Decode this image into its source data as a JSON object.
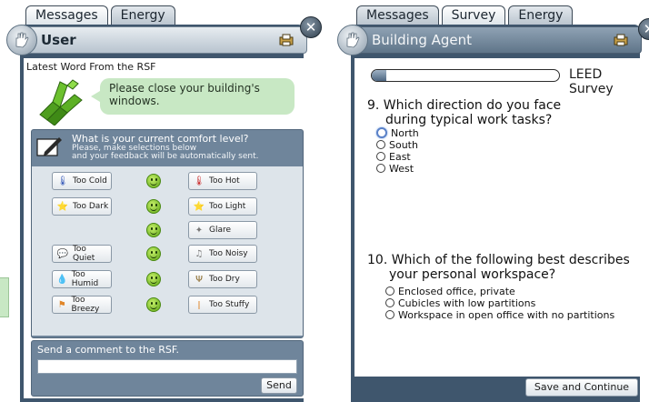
{
  "user_panel": {
    "tabs": [
      "Messages",
      "Energy"
    ],
    "title": "User",
    "latest_word_label": "Latest Word From the RSF",
    "message": "Please close your building's windows.",
    "comfort": {
      "question": "What is your current comfort level?",
      "note_line1": "Please, make selections below",
      "note_line2": "and your feedback will be automatically sent.",
      "left_buttons": [
        {
          "label": "Too Cold",
          "icon": "thermometer-cold-icon"
        },
        {
          "label": "Too Dark",
          "icon": "lamp-icon"
        },
        {
          "label": "Too Quiet",
          "icon": "speech-bubble-icon"
        },
        {
          "label": "Too Humid",
          "icon": "water-drop-icon"
        },
        {
          "label": "Too Breezy",
          "icon": "flag-icon"
        }
      ],
      "right_buttons": [
        {
          "label": "Too Hot",
          "icon": "thermometer-hot-icon"
        },
        {
          "label": "Too Light",
          "icon": "lamp-bright-icon"
        },
        {
          "label": "Glare",
          "icon": "glare-icon"
        },
        {
          "label": "Too Noisy",
          "icon": "noise-icon"
        },
        {
          "label": "Too Dry",
          "icon": "cactus-icon"
        },
        {
          "label": "Too Stuffy",
          "icon": "candle-icon"
        }
      ]
    },
    "comment_label": "Send a comment to the RSF.",
    "comment_value": "",
    "send_label": "Send"
  },
  "survey_panel": {
    "tabs": [
      "Messages",
      "Survey",
      "Energy"
    ],
    "active_tab": "Survey",
    "title": "Building Agent",
    "progress_label": "LEED Survey",
    "progress_fraction": 0.08,
    "q9_line1": "9. Which direction do you face",
    "q9_line2": "during typical work tasks?",
    "q9_options": [
      "North",
      "South",
      "East",
      "West"
    ],
    "q10_line1": "10. Which of the following best describes",
    "q10_line2": "your personal workspace?",
    "q10_options": [
      "Enclosed office, private",
      "Cubicles with low partitions",
      "Workspace in open office with no partitions"
    ],
    "save_label": "Save and Continue"
  },
  "colors": {
    "frame": "#3f566d",
    "bubble": "#c8e8c4",
    "comfort_panel": "#6f859b",
    "smiley": "#7ccf22"
  }
}
